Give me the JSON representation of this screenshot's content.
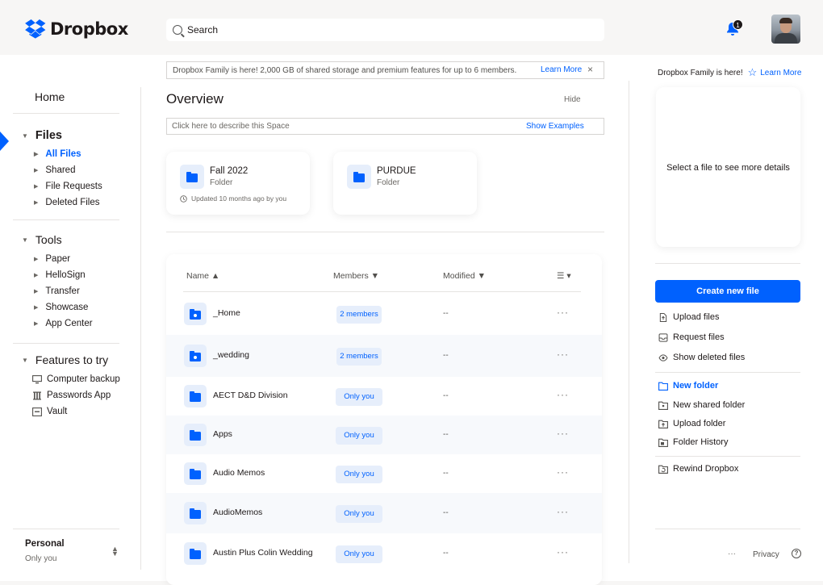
{
  "header": {
    "brand": "Dropbox",
    "search_placeholder": "Search",
    "notification_count": "1",
    "colors": {
      "accent": "#0061fe",
      "text": "#1e1919",
      "muted": "#6b6864"
    }
  },
  "sidebar": {
    "home": "Home",
    "files": {
      "label": "Files",
      "items": [
        "All Files",
        "Shared",
        "File Requests",
        "Deleted Files"
      ],
      "active": "All Files"
    },
    "tools": {
      "label": "Tools",
      "items": [
        "Paper",
        "HelloSign",
        "Transfer",
        "Showcase",
        "App Center"
      ]
    },
    "features": {
      "label": "Features to try",
      "items": [
        {
          "label": "Computer backup",
          "icon": "monitor-icon"
        },
        {
          "label": "Passwords App",
          "icon": "password-icon"
        },
        {
          "label": "Vault",
          "icon": "vault-icon"
        }
      ]
    },
    "account": {
      "name": "Personal",
      "sub": "Only you"
    }
  },
  "main": {
    "banner": {
      "text": "Dropbox Family is here! 2,000 GB of shared storage and premium features for up to 6 members.",
      "learn_more": "Learn More",
      "close": "×"
    },
    "overview": {
      "title": "Overview",
      "hide": "Hide",
      "describe_placeholder": "Click here to describe this Space",
      "show_examples": "Show Examples"
    },
    "suggested": [
      {
        "name": "Fall 2022",
        "type": "Folder",
        "updated": "Updated 10 months ago by you"
      },
      {
        "name": "PURDUE",
        "type": "Folder"
      }
    ],
    "table": {
      "columns": {
        "name": "Name ▲",
        "members": "Members ▼",
        "modified": "Modified ▼",
        "view": "☰ ▾"
      },
      "rows": [
        {
          "name": "_Home",
          "members": "2 members",
          "modified": "--",
          "icon": "shared-folder-icon"
        },
        {
          "name": "_wedding",
          "members": "2 members",
          "modified": "--",
          "icon": "shared-folder-icon"
        },
        {
          "name": "AECT D&D Division",
          "members": "Only you",
          "modified": "--",
          "icon": "folder-icon"
        },
        {
          "name": "Apps",
          "members": "Only you",
          "modified": "--",
          "icon": "folder-icon"
        },
        {
          "name": "Audio Memos",
          "members": "Only you",
          "modified": "--",
          "icon": "folder-icon"
        },
        {
          "name": "AudioMemos",
          "members": "Only you",
          "modified": "--",
          "icon": "folder-icon"
        },
        {
          "name": "Austin Plus Colin Wedding",
          "members": "Only you",
          "modified": "--",
          "icon": "folder-icon"
        }
      ],
      "more": "···"
    }
  },
  "right_panel": {
    "banner": "Dropbox Family is here!",
    "learn_more": "Learn More",
    "details_text": "Select a file to see more details",
    "create_button": "Create new file",
    "actions_1": [
      "Upload files",
      "Request files",
      "Show deleted files"
    ],
    "actions_2": [
      "New folder",
      "New shared folder",
      "Upload folder",
      "Folder History"
    ],
    "actions_3": [
      "Rewind Dropbox"
    ],
    "footer": {
      "more": "···",
      "privacy": "Privacy",
      "help": "?"
    }
  }
}
